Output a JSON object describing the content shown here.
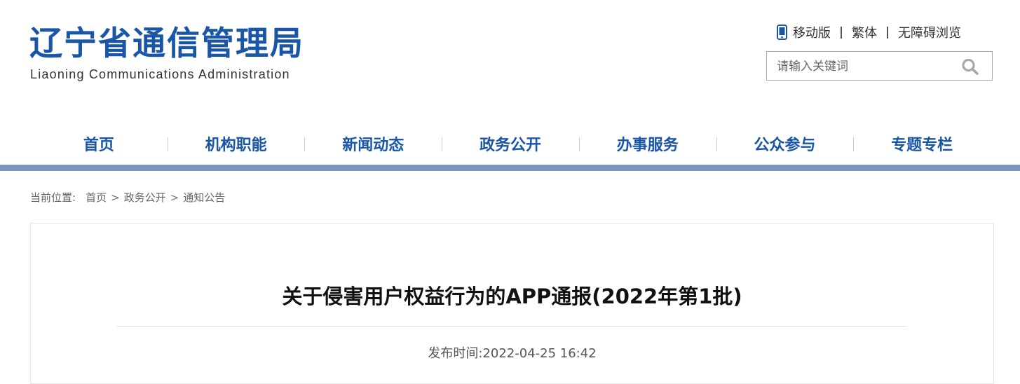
{
  "header": {
    "logo_cn": "辽宁省通信管理局",
    "logo_en": "Liaoning Communications Administration",
    "links": {
      "mobile": "移动版",
      "traditional": "繁体",
      "accessible": "无障碍浏览"
    },
    "search": {
      "placeholder": "请输入关键词",
      "icon": "search-icon"
    }
  },
  "nav": {
    "items": [
      "首页",
      "机构职能",
      "新闻动态",
      "政务公开",
      "办事服务",
      "公众参与",
      "专题专栏"
    ]
  },
  "breadcrumb": {
    "label": "当前位置:",
    "items": [
      "首页",
      "政务公开",
      "通知公告"
    ]
  },
  "article": {
    "title": "关于侵害用户权益行为的APP通报(2022年第1批)",
    "publish_label": "发布时间:",
    "publish_time": "2022-04-25 16:42"
  },
  "colors": {
    "brand": "#1a56a7",
    "nav_bar": "#7a95c0"
  }
}
